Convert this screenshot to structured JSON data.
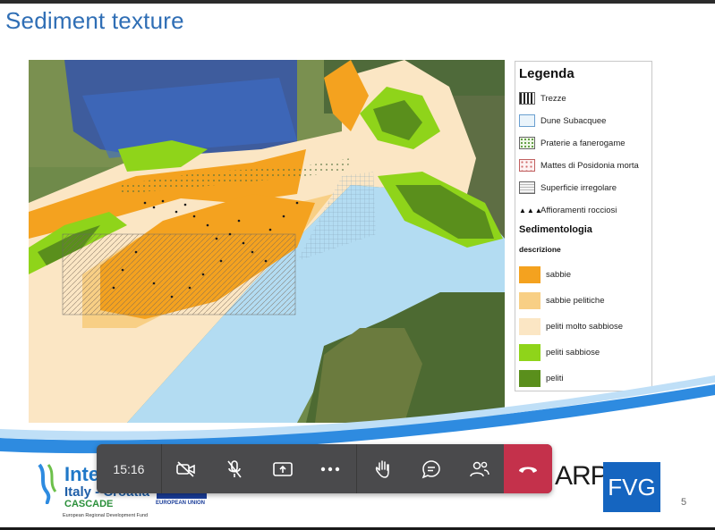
{
  "slide": {
    "title": "Sediment texture",
    "page_number": "5"
  },
  "legend": {
    "title": "Legenda",
    "symbols": [
      {
        "label": "Trezze",
        "icon": "trezze-pattern-icon"
      },
      {
        "label": "Dune Subacquee",
        "icon": "dune-pattern-icon"
      },
      {
        "label": "Praterie a fanerogame",
        "icon": "seagrass-pattern-icon"
      },
      {
        "label": "Mattes di Posidonia morta",
        "icon": "posidonia-pattern-icon"
      },
      {
        "label": "Superficie irregolare",
        "icon": "irregular-surface-pattern-icon"
      },
      {
        "label": "Affioramenti rocciosi",
        "icon": "rock-outcrop-icon"
      }
    ],
    "section_title": "Sedimentologia",
    "section_subtitle": "descrizione",
    "classes": [
      {
        "label": "sabbie",
        "color": "#f4a21f"
      },
      {
        "label": "sabbie pelitiche",
        "color": "#f8cf85"
      },
      {
        "label": "peliti molto sabbiose",
        "color": "#fbe6c4"
      },
      {
        "label": "peliti sabbiose",
        "color": "#8fd41a"
      },
      {
        "label": "peliti",
        "color": "#5a8f1c"
      }
    ]
  },
  "footer": {
    "brand_line1": "Interreg",
    "brand_line2": "Italy - Croatia",
    "brand_line3": "CASCADE",
    "brand_line4": "European Regional Development Fund",
    "eu_label": "EUROPEAN UNION",
    "agency_prefix": "ARPA",
    "agency_box": "FVG"
  },
  "call_controls": {
    "timer": "15:16",
    "buttons": [
      {
        "name": "camera-off-icon"
      },
      {
        "name": "mic-off-icon"
      },
      {
        "name": "share-screen-icon"
      },
      {
        "name": "more-options-icon"
      },
      {
        "name": "raise-hand-icon"
      },
      {
        "name": "chat-icon"
      },
      {
        "name": "participants-icon"
      },
      {
        "name": "hang-up-icon"
      }
    ],
    "colors": {
      "bar": "#4a4a4c",
      "hangup": "#c4314b"
    }
  }
}
